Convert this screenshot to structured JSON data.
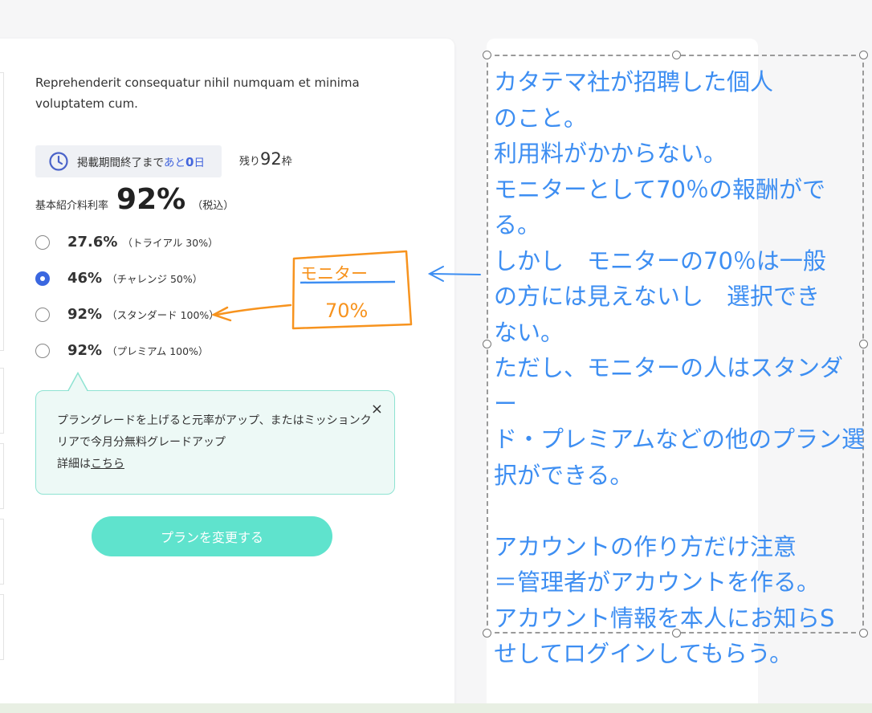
{
  "card": {
    "description": "Reprehenderit consequatur nihil numquam et minima voluptatem cum.",
    "period": {
      "prefix": "掲載期間終了まで",
      "highlight_label": "あと",
      "highlight_value": "0",
      "suffix": "日"
    },
    "remaining": {
      "prefix": "残り",
      "value": "92",
      "suffix": "枠"
    },
    "rate": {
      "label": "基本紹介料利率",
      "value": "92%",
      "note": "（税込）"
    },
    "options": [
      {
        "percent": "27.6%",
        "plan": "（トライアル 30%）",
        "selected": false
      },
      {
        "percent": "46%",
        "plan": "（チャレンジ 50%）",
        "selected": true
      },
      {
        "percent": "92%",
        "plan": "（スタンダード 100%）",
        "selected": false
      },
      {
        "percent": "92%",
        "plan": "（プレミアム 100%）",
        "selected": false
      }
    ],
    "tooltip": {
      "text": "プラングレードを上げると元率がアップ、またはミッションクリアで今月分無料グレードアップ",
      "detail_prefix": "詳細は",
      "detail_link": "こちら",
      "close": "×"
    },
    "button": "プランを変更する"
  },
  "annotation": {
    "handwritten_top": "モニター",
    "handwritten_bottom": "70%",
    "note": "カタテマ社が招聘した個人\nのこと。\n利用料がかからない。\nモニターとして70％の報酬がで\nる。\nしかし　モニターの70％は一般\nの方には見えないし　選択でき\nない。\nただし、モニターの人はスタンダー\nド・プレミアムなどの他のプラン選\n択ができる。\n\nアカウントの作り方だけ注意\n＝管理者がアカウントを作る。\nアカウント情報を本人にお知らS\nせしてログインしてもらう。"
  },
  "colors": {
    "accent_blue": "#3a67e0",
    "button_teal": "#5fe3cd",
    "tooltip_bg": "#edf9f6",
    "annotation_orange": "#f7931e",
    "annotation_blue": "#3d8ef2"
  }
}
